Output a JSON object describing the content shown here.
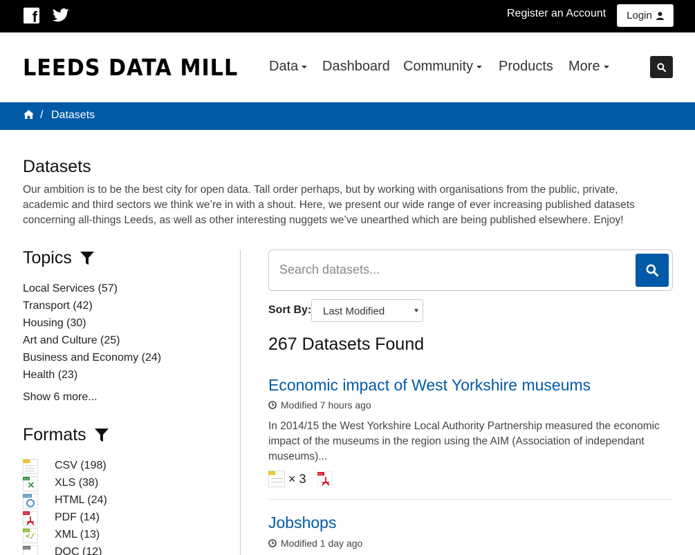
{
  "topbar": {
    "register_label": "Register an Account",
    "login_label": "Login"
  },
  "header": {
    "logo": "LEEDS DATA MILL",
    "nav": [
      {
        "label": "Data",
        "dropdown": true
      },
      {
        "label": "Dashboard",
        "dropdown": false
      },
      {
        "label": "Community",
        "dropdown": true
      },
      {
        "label": "Products",
        "dropdown": false
      },
      {
        "label": "More",
        "dropdown": true
      }
    ]
  },
  "breadcrumb": {
    "separator": "/",
    "current": "Datasets"
  },
  "page": {
    "title": "Datasets",
    "intro": "Our ambition is to be the best city for open data. Tall order perhaps, but by working with organisations from the public, private, academic and third sectors we think we’re in with a shout. Here, we present our wide range of ever increasing published datasets concerning all-things Leeds, as well as other interesting nuggets we’ve unearthed which are being published elsewhere. Enjoy!"
  },
  "topics": {
    "title": "Topics",
    "items": [
      "Local Services (57)",
      "Transport (42)",
      "Housing (30)",
      "Art and Culture (25)",
      "Business and Economy (24)",
      "Health (23)"
    ],
    "show_more": "Show 6 more..."
  },
  "formats": {
    "title": "Formats",
    "items": [
      {
        "label": "CSV (198)",
        "icon": "csv-icon",
        "color": "#e8b800"
      },
      {
        "label": "XLS (38)",
        "icon": "xls-icon",
        "color": "#2e8b3a"
      },
      {
        "label": "HTML (24)",
        "icon": "html-icon",
        "color": "#4a90c2"
      },
      {
        "label": "PDF (14)",
        "icon": "pdf-icon",
        "color": "#d0021b"
      },
      {
        "label": "XML (13)",
        "icon": "xml-icon",
        "color": "#7ab317"
      },
      {
        "label": "DOC (12)",
        "icon": "doc-icon",
        "color": "#666666"
      }
    ]
  },
  "search": {
    "placeholder": "Search datasets...",
    "sort_label": "Sort By:",
    "sort_value": "Last Modified"
  },
  "results": {
    "found": "267 Datasets Found",
    "datasets": [
      {
        "title": "Economic impact of West Yorkshire museums",
        "modified": "Modified 7 hours ago",
        "description": "In 2014/15 the West Yorkshire Local Authority Partnership measured the economic impact of the museums in the region using the AIM (Association of independant museums)...",
        "csv_count": "× 3"
      },
      {
        "title": "Jobshops",
        "modified": "Modified 1 day ago"
      }
    ]
  },
  "colors": {
    "brand_blue": "#005aa7",
    "topbar": "#000000"
  }
}
